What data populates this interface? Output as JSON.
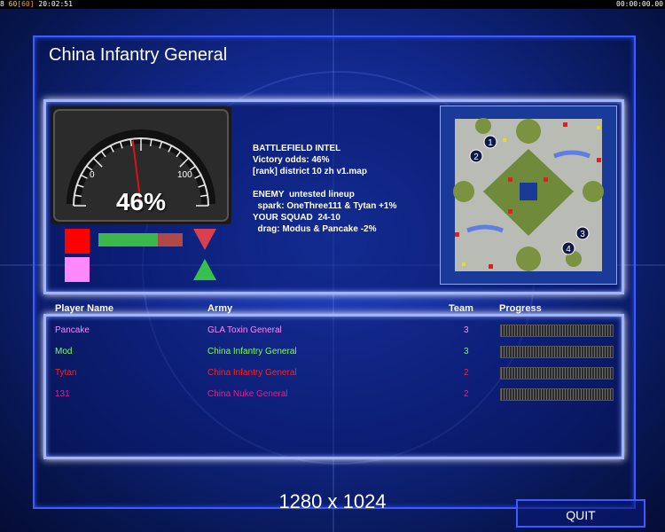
{
  "status_bar": {
    "fps_a": "8",
    "fps_b": "60",
    "fps_c": "[60]",
    "time": "20:02:51",
    "clock": "00:00:00.00"
  },
  "title": "China Infantry General",
  "gauge": {
    "value_percent": 46,
    "label_percent": "46%",
    "min_label": "0",
    "max_label": "100"
  },
  "colors": {
    "accent": "#3d5cff",
    "panel_border": "#9fb3ff",
    "red_square": "#ff0000",
    "pink_square": "#ff88ff",
    "bar_green": "#3cb84a",
    "bar_red": "#b04848",
    "arrow_down": "#d84050",
    "arrow_up": "#36c24a"
  },
  "win_bar": {
    "green_fraction": 0.7
  },
  "intel": {
    "heading": "BATTLEFIELD INTEL",
    "odds": "Victory odds: 46%",
    "map": "[rank] district 10 zh v1.map",
    "enemy": "ENEMY  untested lineup",
    "spark": "  spark: OneThree111 & Tytan +1%",
    "squad": "YOUR SQUAD  24-10",
    "drag": "  drag: Modus & Pancake -2%"
  },
  "minimap": {
    "start_positions": [
      "1",
      "2",
      "3",
      "4"
    ]
  },
  "table": {
    "headers": {
      "player": "Player Name",
      "army": "Army",
      "team": "Team",
      "progress": "Progress"
    },
    "rows": [
      {
        "player": "Pancake",
        "army": "GLA Toxin General",
        "team": "3",
        "color": "#ff88ff",
        "army_color": "#ff88ff"
      },
      {
        "player": "Mod",
        "army": "China Infantry General",
        "team": "3",
        "color": "#7dff5a",
        "army_color": "#7dff5a"
      },
      {
        "player": "Tytan",
        "army": "China Infantry General",
        "team": "2",
        "color": "#ff2020",
        "army_color": "#ff2020"
      },
      {
        "player": "131",
        "army": "China Nuke General",
        "team": "2",
        "color": "#e02090",
        "army_color": "#e02090"
      }
    ]
  },
  "resolution": "1280 x 1024",
  "quit_label": "QUIT"
}
